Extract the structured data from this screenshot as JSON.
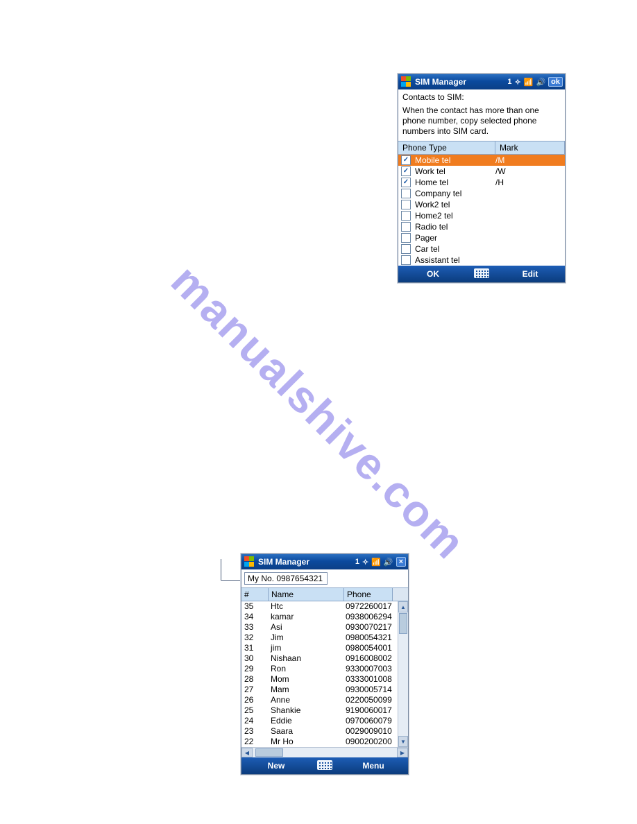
{
  "watermark": "manualshive.com",
  "screen1": {
    "title": "SIM Manager",
    "title_num": "1",
    "ok": "ok",
    "info_heading": "Contacts to SIM:",
    "info_body": "When the contact has more than one phone number, copy selected phone numbers into SIM card.",
    "col_type": "Phone Type",
    "col_mark": "Mark",
    "rows": [
      {
        "label": "Mobile tel",
        "mark": "/M",
        "checked": true,
        "selected": true
      },
      {
        "label": "Work tel",
        "mark": "/W",
        "checked": true,
        "selected": false
      },
      {
        "label": "Home tel",
        "mark": "/H",
        "checked": true,
        "selected": false
      },
      {
        "label": "Company tel",
        "mark": "",
        "checked": false,
        "selected": false
      },
      {
        "label": "Work2 tel",
        "mark": "",
        "checked": false,
        "selected": false
      },
      {
        "label": "Home2 tel",
        "mark": "",
        "checked": false,
        "selected": false
      },
      {
        "label": "Radio tel",
        "mark": "",
        "checked": false,
        "selected": false
      },
      {
        "label": "Pager",
        "mark": "",
        "checked": false,
        "selected": false
      },
      {
        "label": "Car tel",
        "mark": "",
        "checked": false,
        "selected": false
      },
      {
        "label": "Assistant tel",
        "mark": "",
        "checked": false,
        "selected": false
      }
    ],
    "soft_left": "OK",
    "soft_right": "Edit"
  },
  "screen2": {
    "title": "SIM Manager",
    "title_num": "1",
    "close": "×",
    "my_no_label": "My No. 0987654321",
    "col_num": "#",
    "col_name": "Name",
    "col_phone": "Phone",
    "rows": [
      {
        "n": "35",
        "name": "Htc",
        "phone": "0972260017"
      },
      {
        "n": "34",
        "name": "kamar",
        "phone": "0938006294"
      },
      {
        "n": "33",
        "name": "Asi",
        "phone": "0930070217"
      },
      {
        "n": "32",
        "name": "Jim",
        "phone": "0980054321"
      },
      {
        "n": "31",
        "name": "jim",
        "phone": "0980054001"
      },
      {
        "n": "30",
        "name": "Nishaan",
        "phone": "0916008002"
      },
      {
        "n": "29",
        "name": "Ron",
        "phone": "9330007003"
      },
      {
        "n": "28",
        "name": "Mom",
        "phone": "0333001008"
      },
      {
        "n": "27",
        "name": "Mam",
        "phone": "0930005714"
      },
      {
        "n": "26",
        "name": "Anne",
        "phone": "0220050099"
      },
      {
        "n": "25",
        "name": "Shankie",
        "phone": "9190060017"
      },
      {
        "n": "24",
        "name": "Eddie",
        "phone": "0970060079"
      },
      {
        "n": "23",
        "name": "Saara",
        "phone": "0029009010"
      },
      {
        "n": "22",
        "name": "Mr Ho",
        "phone": "0900200200"
      }
    ],
    "soft_left": "New",
    "soft_right": "Menu"
  }
}
